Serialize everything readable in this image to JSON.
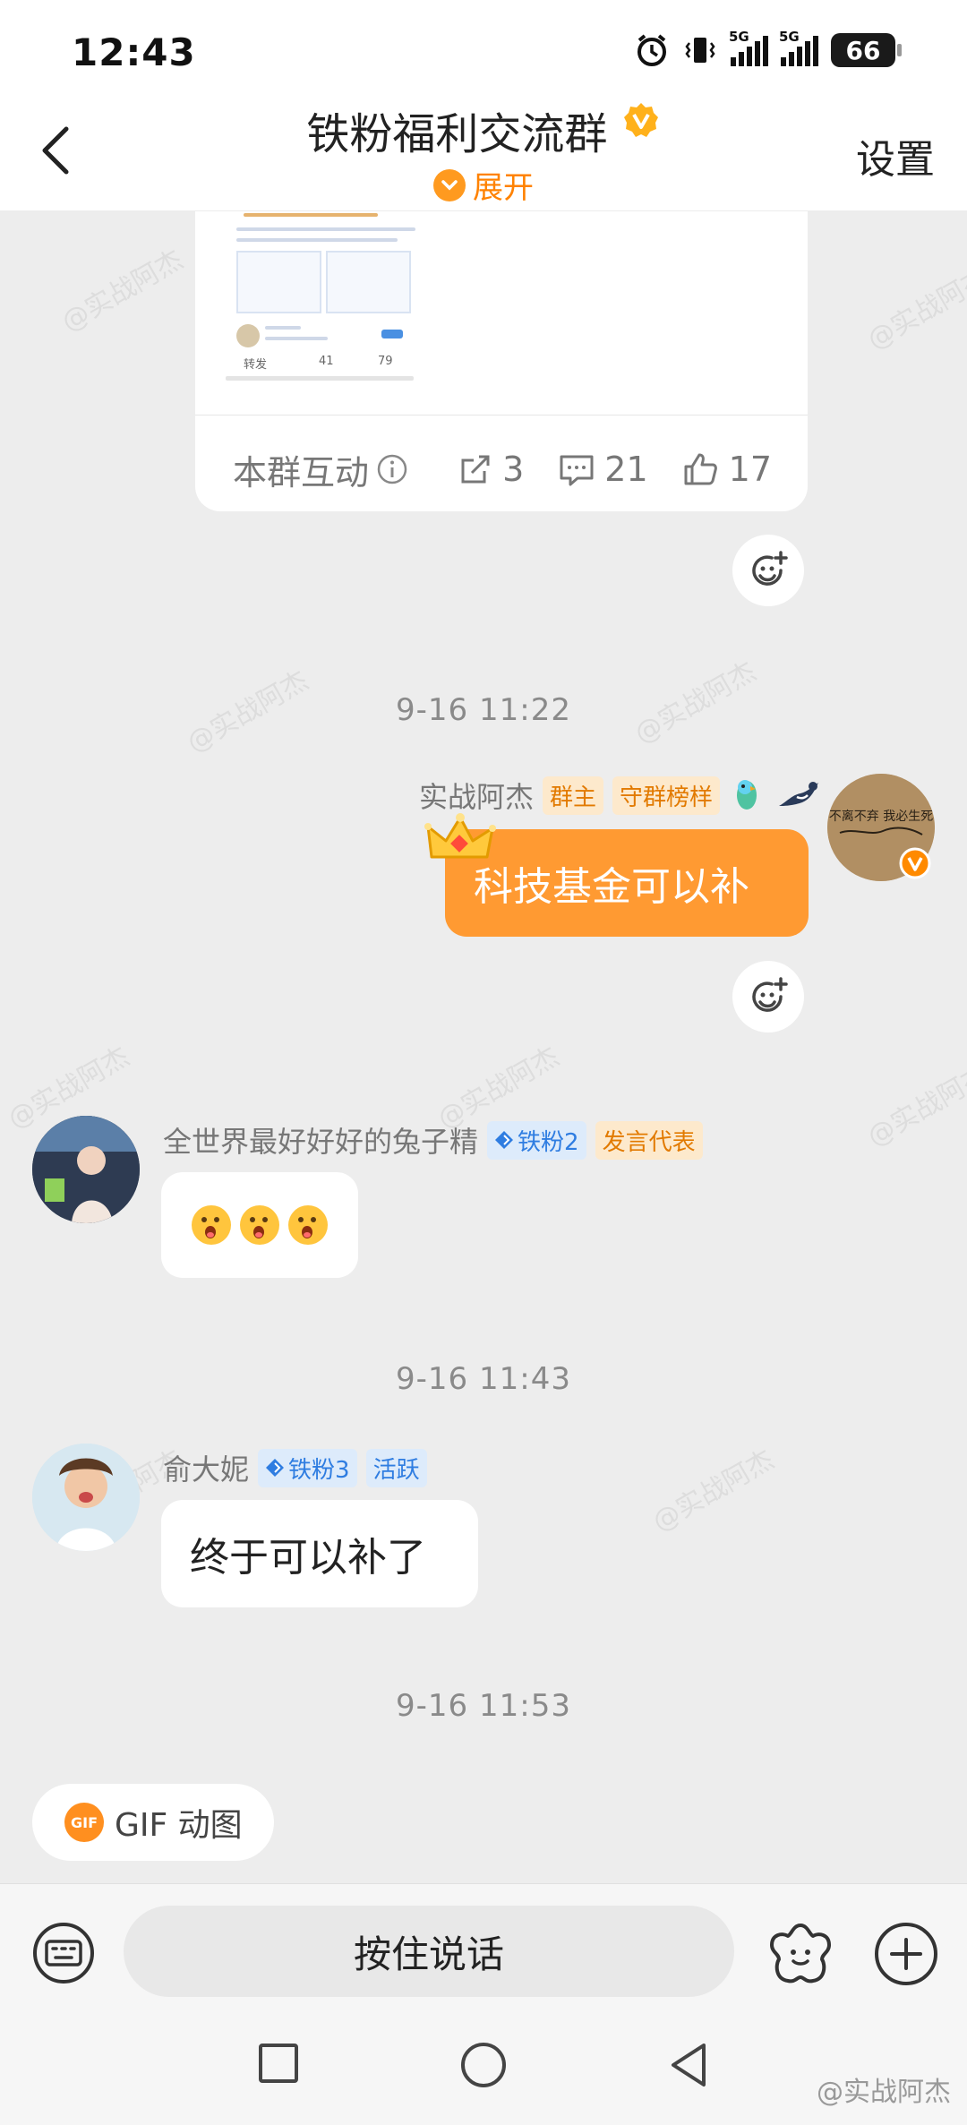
{
  "status_bar": {
    "time": "12:43",
    "signal_1": "5G",
    "signal_2": "5G",
    "battery": "66"
  },
  "nav": {
    "title": "铁粉福利交流群",
    "expand_label": "展开",
    "settings_label": "设置"
  },
  "card": {
    "thumb": {
      "forward_label": "转发",
      "comment_count": "41",
      "like_count": "79"
    },
    "interaction_label": "本群互动",
    "share_count": "3",
    "comment_count": "21",
    "like_count": "17"
  },
  "messages": [
    {
      "timestamp": "9-16 11:22",
      "sender": "实战阿杰",
      "tags": [
        "群主",
        "守群榜样"
      ],
      "text": "科技基金可以补",
      "avatar_text": "你若不离不弃 我必生死相依"
    },
    {
      "sender": "全世界最好好好的兔子精",
      "level_tag": "铁粉2",
      "role_tag": "发言代表",
      "text": "😲😲😲"
    },
    {
      "timestamp": "9-16 11:43",
      "sender": "俞大妮",
      "level_tag": "铁粉3",
      "role_tag": "活跃",
      "text": "终于可以补了"
    },
    {
      "timestamp": "9-16 11:53"
    }
  ],
  "gif_chip": {
    "icon_text": "GIF",
    "label": "GIF 动图"
  },
  "input_bar": {
    "hold_to_talk": "按住说话"
  },
  "watermark": "@实战阿杰",
  "colors": {
    "accent_orange": "#ff8200",
    "bubble_orange": "#ff9a32",
    "tag_blue": "#2f7de1"
  }
}
